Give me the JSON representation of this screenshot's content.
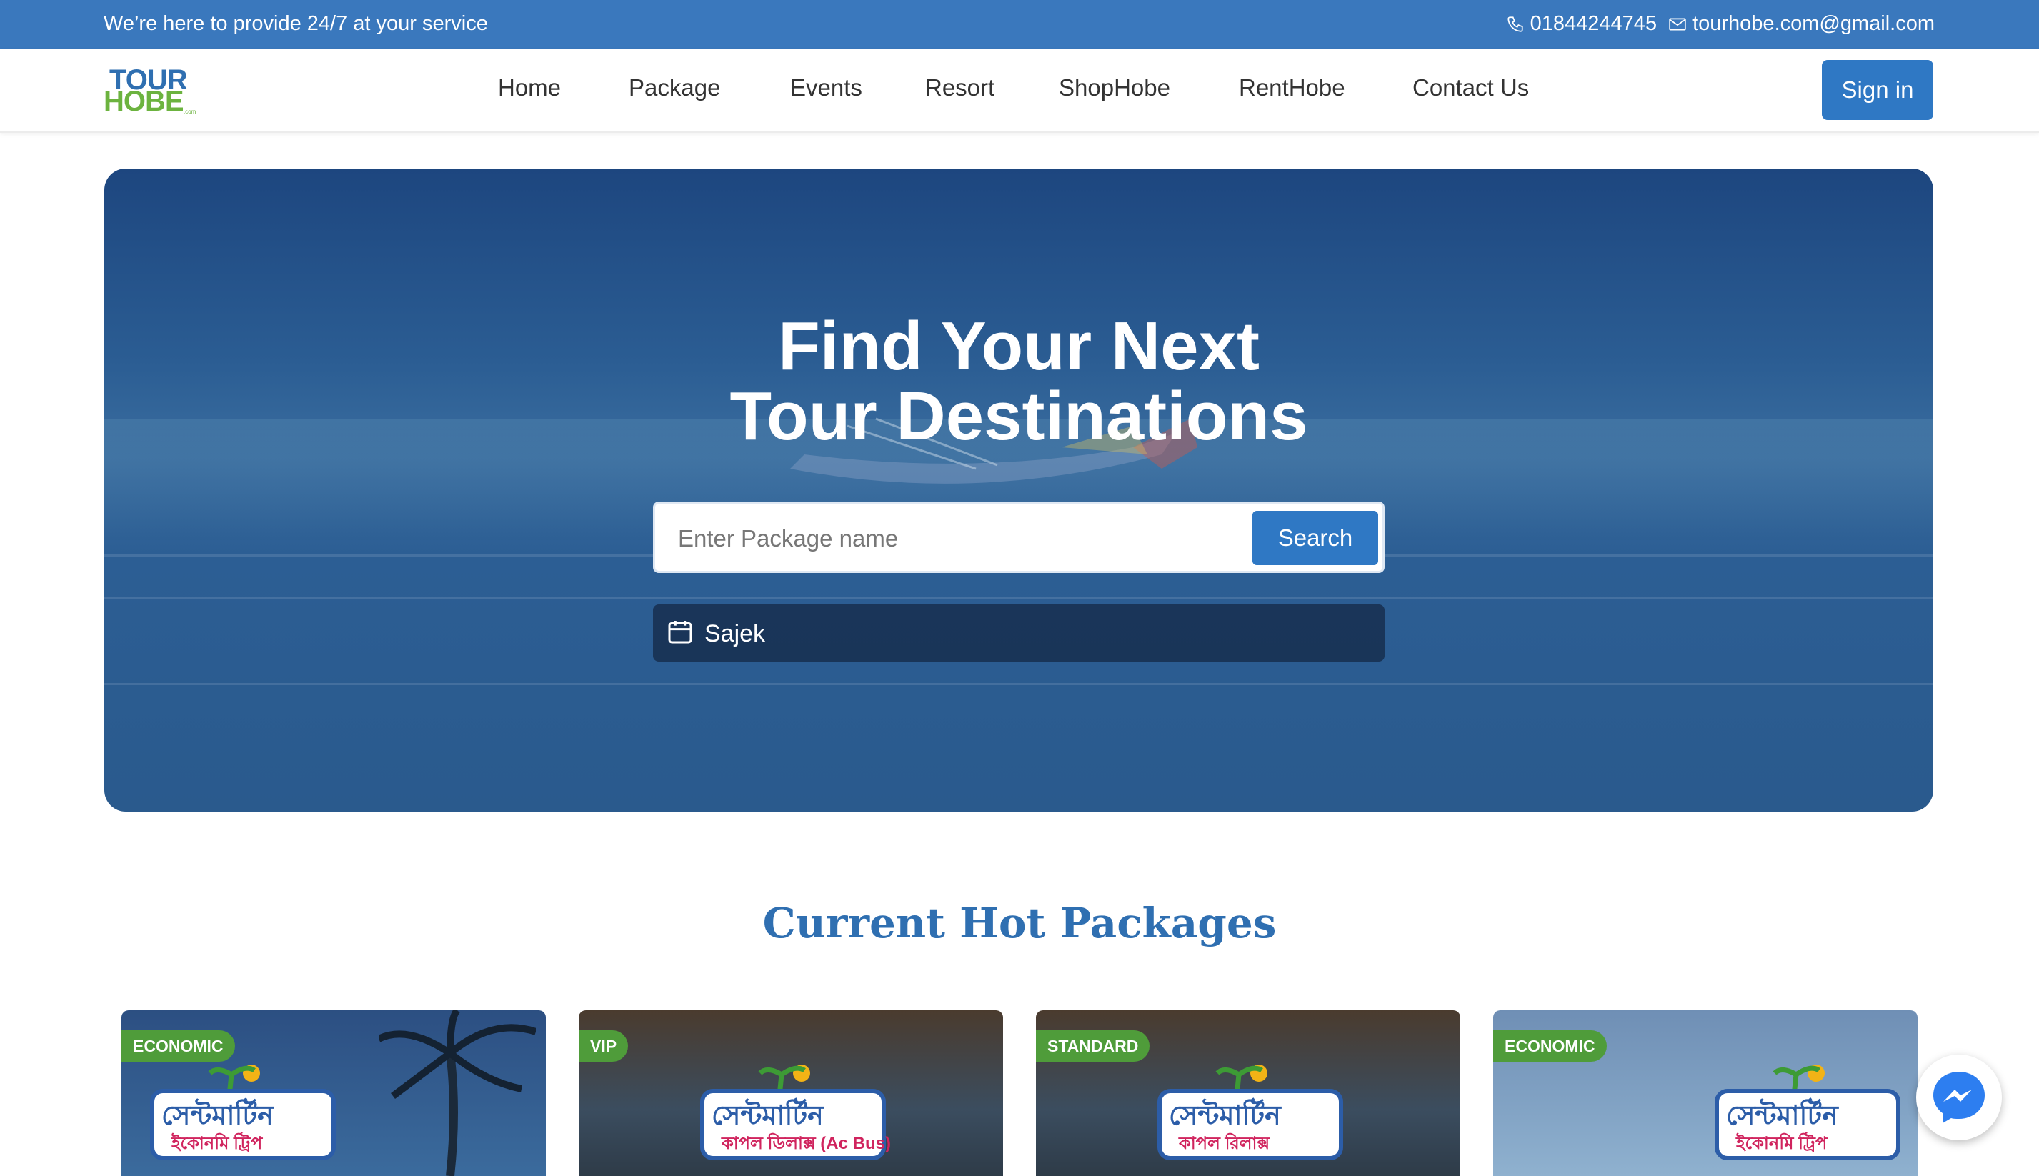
{
  "topbar": {
    "tagline": "We’re here to provide 24/7 at your service",
    "phone": "01844244745",
    "email": "tourhobe.com@gmail.com",
    "phone_icon": "phone-icon",
    "email_icon": "envelope-icon"
  },
  "nav": {
    "logo_line1": "TOUR",
    "logo_line2": "HOBE",
    "logo_suffix": ".com",
    "links": [
      "Home",
      "Package",
      "Events",
      "Resort",
      "ShopHobe",
      "RentHobe",
      "Contact Us"
    ],
    "signin_label": "Sign in"
  },
  "hero": {
    "title_line1": "Find Your Next",
    "title_line2": "Tour Destinations",
    "search_placeholder": "Enter Package name",
    "search_button": "Search",
    "date_value": "Sajek",
    "date_icon": "calendar-icon"
  },
  "section": {
    "title": "Current Hot Packages"
  },
  "cards": [
    {
      "badge": "ECONOMIC",
      "sign_title": "সেন্টমার্টিন",
      "sign_sub": "ইকোনমি ট্রিপ"
    },
    {
      "badge": "VIP",
      "sign_title": "সেন্টমার্টিন",
      "sign_sub": "কাপল ডিলাক্স (Ac Bus)"
    },
    {
      "badge": "STANDARD",
      "sign_title": "সেন্টমার্টিন",
      "sign_sub": "কাপল রিলাক্স"
    },
    {
      "badge": "ECONOMIC",
      "sign_title": "সেন্টমার্টিন",
      "sign_sub": "ইকোনমি ট্রিপ"
    }
  ],
  "colors": {
    "primary": "#2f78c4",
    "topbar": "#3a78bd",
    "logo_green": "#6cb33f",
    "badge_green": "#4f9c3a"
  },
  "widget": {
    "icon": "messenger-icon"
  }
}
